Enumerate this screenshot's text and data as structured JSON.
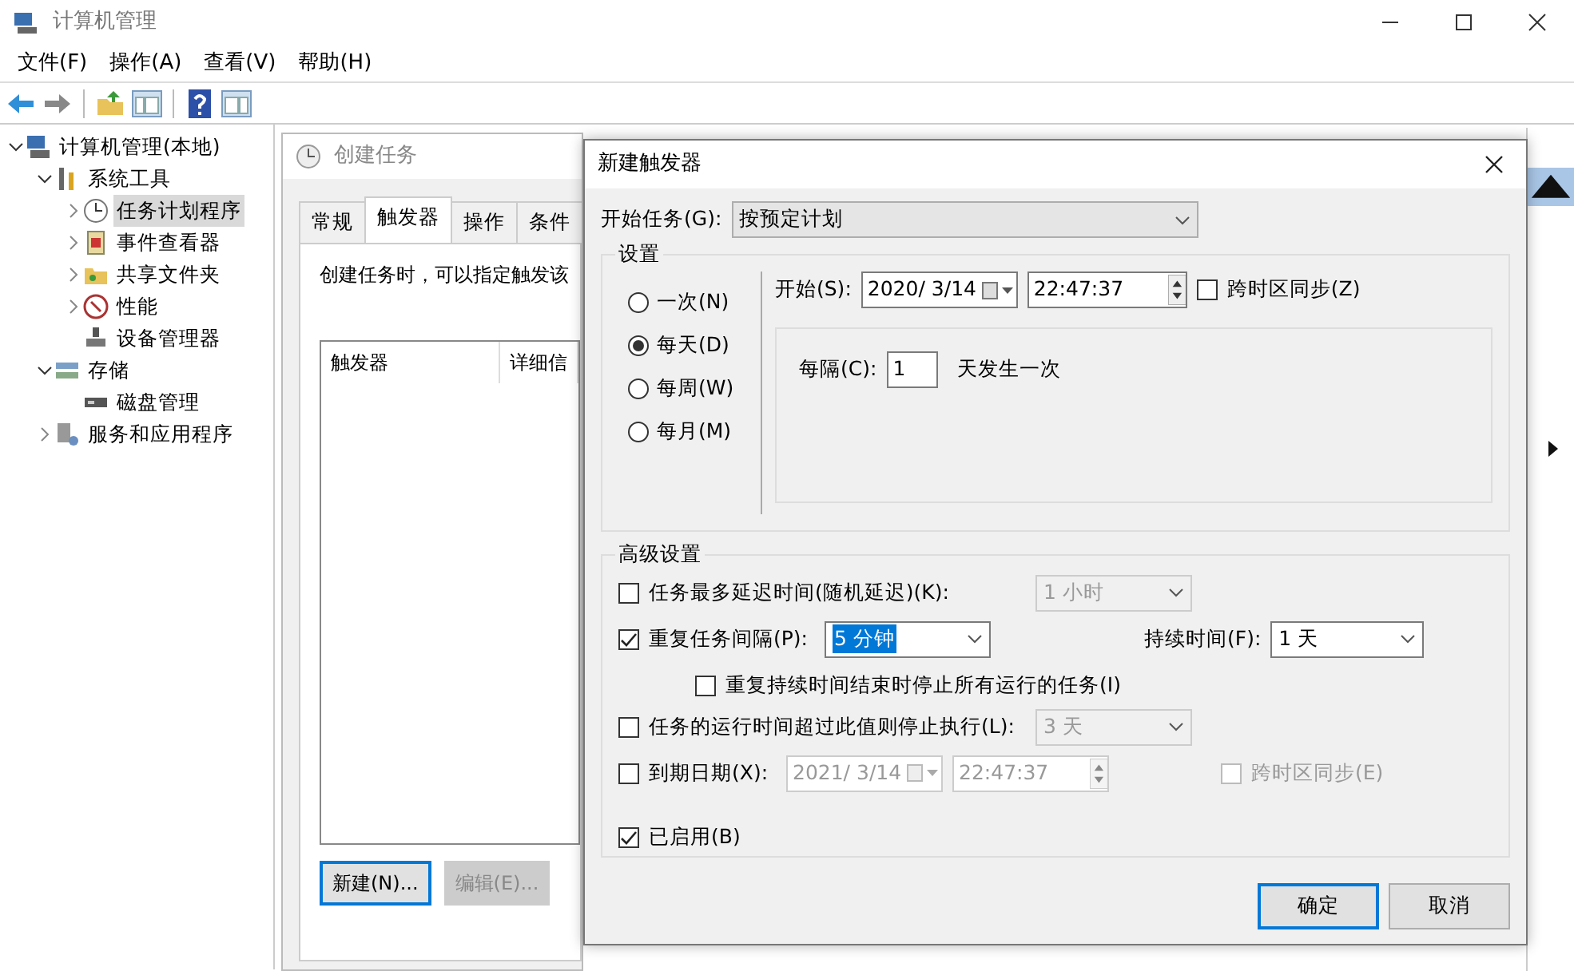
{
  "window": {
    "title": "计算机管理"
  },
  "menu": [
    "文件(F)",
    "操作(A)",
    "查看(V)",
    "帮助(H)"
  ],
  "tree": [
    {
      "label": "计算机管理(本地)",
      "expanded": true,
      "selected": false,
      "children": [
        {
          "label": "系统工具",
          "expanded": true,
          "selected": false,
          "children": [
            {
              "label": "任务计划程序",
              "expanded": false,
              "selected": true
            },
            {
              "label": "事件查看器",
              "expanded": false,
              "selected": false
            },
            {
              "label": "共享文件夹",
              "expanded": false,
              "selected": false
            },
            {
              "label": "性能",
              "expanded": false,
              "selected": false
            },
            {
              "label": "设备管理器",
              "selected": false
            }
          ]
        },
        {
          "label": "存储",
          "expanded": true,
          "selected": false,
          "children": [
            {
              "label": "磁盘管理",
              "selected": false
            }
          ]
        },
        {
          "label": "服务和应用程序",
          "expanded": false,
          "selected": false
        }
      ]
    }
  ],
  "create_task": {
    "title": "创建任务",
    "tabs": [
      {
        "label": "常规",
        "selected": false
      },
      {
        "label": "触发器",
        "selected": true
      },
      {
        "label": "操作",
        "selected": false
      },
      {
        "label": "条件",
        "selected": false
      }
    ],
    "description": "创建任务时，可以指定触发该",
    "columns": [
      "触发器",
      "详细信"
    ],
    "buttons": [
      {
        "label": "新建(N)...",
        "disabled": false
      },
      {
        "label": "编辑(E)...",
        "disabled": true
      }
    ]
  },
  "dialog": {
    "title": "新建触发器",
    "begin_task": {
      "label": "开始任务(G):",
      "value": "按预定计划"
    },
    "settings": {
      "legend": "设置",
      "options": [
        {
          "label": "一次(N)",
          "selected": false
        },
        {
          "label": "每天(D)",
          "selected": true
        },
        {
          "label": "每周(W)",
          "selected": false
        },
        {
          "label": "每月(M)",
          "selected": false
        }
      ],
      "start_label": "开始(S):",
      "date": "2020/  3/14",
      "time": "22:47:37",
      "sync": {
        "label": "跨时区同步(Z)",
        "checked": false
      },
      "recur_label": "每隔(C):",
      "recur_value": "1",
      "recur_suffix": "天发生一次"
    },
    "advanced": {
      "legend": "高级设置",
      "rows": [
        {
          "kind": "dropdown",
          "label": "任务最多延迟时间(随机延迟)(K):",
          "checked": false,
          "value": "1 小时"
        },
        {
          "kind": "repeat",
          "label": "重复任务间隔(P):",
          "checked": true,
          "value": "5 分钟",
          "duration_label": "持续时间(F):",
          "duration": "1 天"
        },
        {
          "kind": "sub",
          "label": "重复持续时间结束时停止所有运行的任务(I)",
          "checked": false
        },
        {
          "kind": "dropdown",
          "label": "任务的运行时间超过此值则停止执行(L):",
          "checked": false,
          "value": "3 天"
        },
        {
          "kind": "expire",
          "label": "到期日期(X):",
          "checked": false,
          "date": "2021/  3/14",
          "time": "22:47:37",
          "sync_label": "跨时区同步(E)",
          "sync_checked": false
        },
        {
          "kind": "check",
          "label": "已启用(B)",
          "checked": true
        }
      ]
    },
    "buttons": [
      {
        "label": "确定",
        "default": true
      },
      {
        "label": "取消",
        "default": false
      }
    ]
  }
}
